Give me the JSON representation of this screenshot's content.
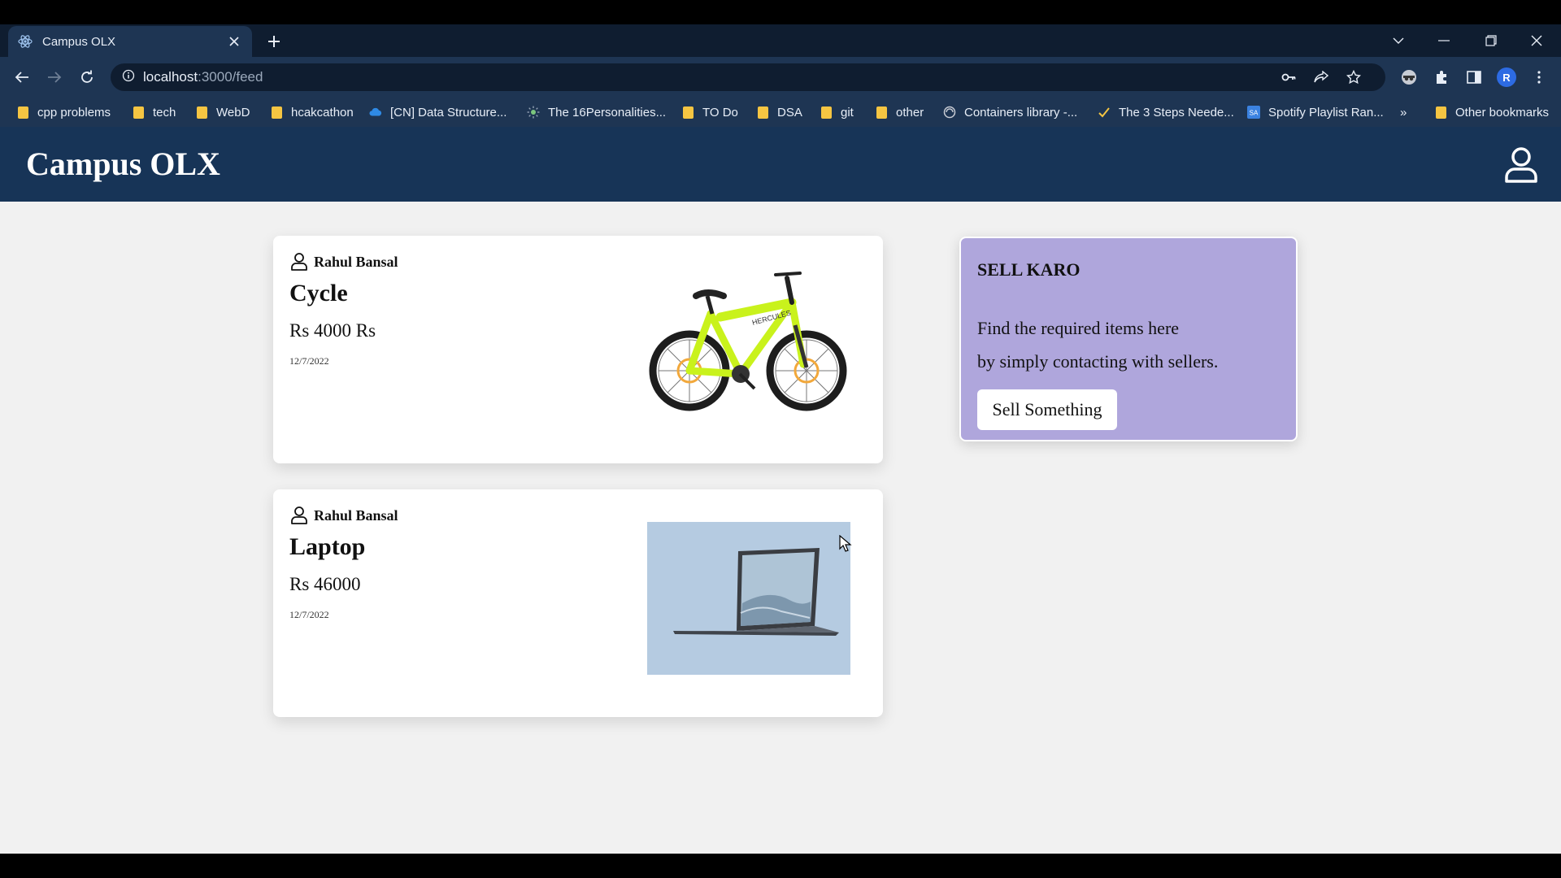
{
  "browser": {
    "tab_title": "Campus OLX",
    "url_host": "localhost",
    "url_path": ":3000/feed",
    "profile_initial": "R",
    "bookmarks": [
      {
        "label": "cpp problems",
        "icon": "folder-icon"
      },
      {
        "label": "tech",
        "icon": "folder-icon"
      },
      {
        "label": "WebD",
        "icon": "folder-icon"
      },
      {
        "label": "hcakcathon",
        "icon": "folder-icon"
      },
      {
        "label": "[CN] Data Structure...",
        "icon": "cloud-icon"
      },
      {
        "label": "The 16Personalities...",
        "icon": "sun-icon"
      },
      {
        "label": "TO Do",
        "icon": "folder-icon"
      },
      {
        "label": "DSA",
        "icon": "folder-icon"
      },
      {
        "label": "git",
        "icon": "folder-icon"
      },
      {
        "label": "other",
        "icon": "folder-icon"
      },
      {
        "label": "Containers library -...",
        "icon": "globe-icon"
      },
      {
        "label": "The 3 Steps Neede...",
        "icon": "check-icon"
      },
      {
        "label": "Spotify Playlist Ran...",
        "icon": "sa-icon"
      }
    ],
    "overflow": "»",
    "other_bookmarks": "Other bookmarks"
  },
  "app": {
    "brand": "Campus OLX",
    "products": [
      {
        "seller": "Rahul Bansal",
        "title": "Cycle",
        "price": "Rs 4000 Rs",
        "date": "12/7/2022",
        "image": "bicycle-image"
      },
      {
        "seller": "Rahul Bansal",
        "title": "Laptop",
        "price": "Rs 46000",
        "date": "12/7/2022",
        "image": "laptop-image"
      }
    ],
    "sell": {
      "title": "SELL KARO",
      "line1": "Find the required items here",
      "line2": "by simply contacting with sellers.",
      "button": "Sell Something"
    }
  },
  "colors": {
    "header": "#173457",
    "sell_card": "#afa6dc",
    "bike_frame": "#c9f21c"
  }
}
